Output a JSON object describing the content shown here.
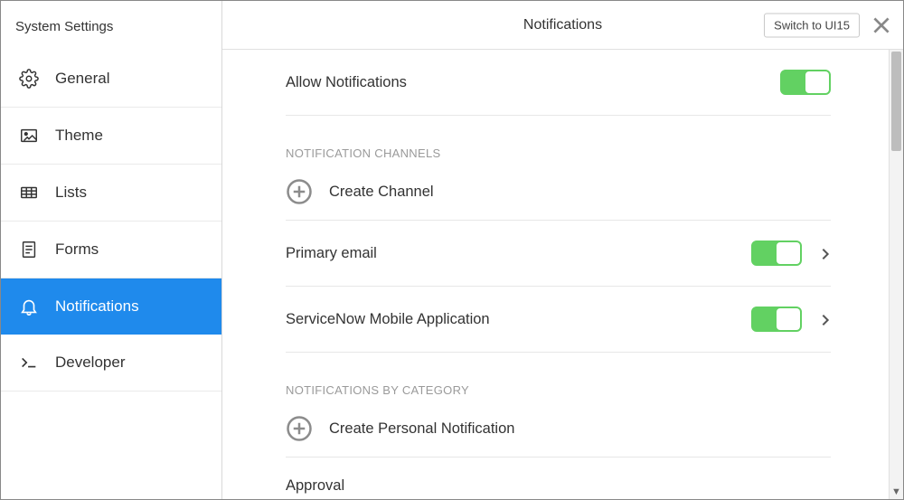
{
  "sidebar": {
    "title": "System Settings",
    "items": [
      {
        "label": "General"
      },
      {
        "label": "Theme"
      },
      {
        "label": "Lists"
      },
      {
        "label": "Forms"
      },
      {
        "label": "Notifications"
      },
      {
        "label": "Developer"
      }
    ]
  },
  "header": {
    "title": "Notifications",
    "switch_label": "Switch to UI15"
  },
  "content": {
    "allow_notifications_label": "Allow Notifications",
    "channels_section_label": "NOTIFICATION CHANNELS",
    "create_channel_label": "Create Channel",
    "channels": [
      {
        "label": "Primary email"
      },
      {
        "label": "ServiceNow Mobile Application"
      }
    ],
    "category_section_label": "NOTIFICATIONS BY CATEGORY",
    "create_personal_label": "Create Personal Notification",
    "categories": [
      {
        "label": "Approval"
      }
    ]
  },
  "colors": {
    "accent": "#1f8aec",
    "toggle_on": "#62d162"
  }
}
